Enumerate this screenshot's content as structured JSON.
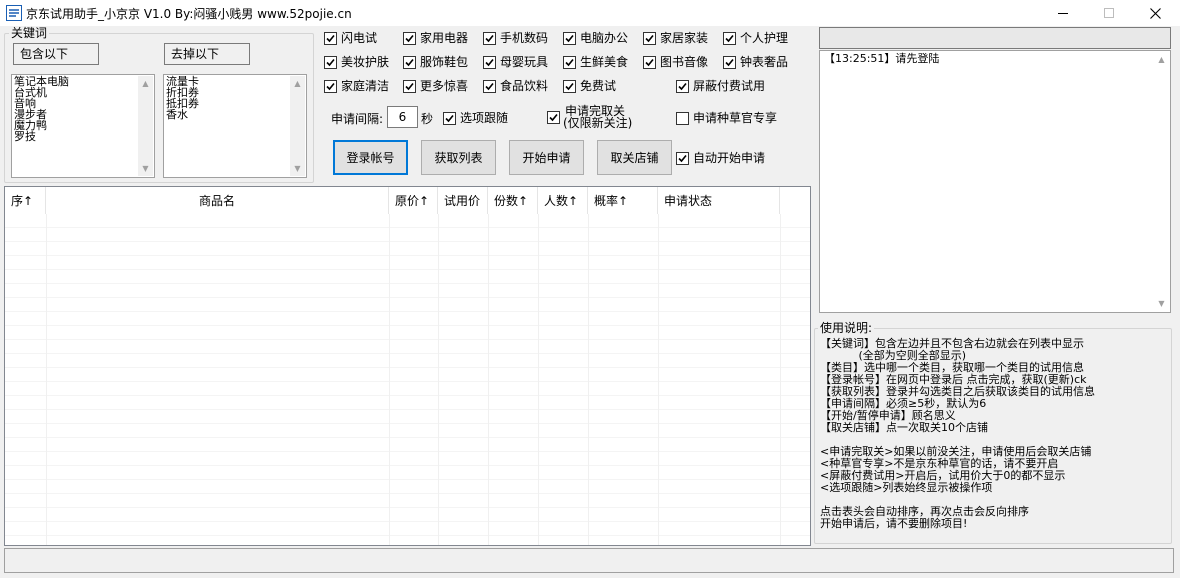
{
  "window": {
    "title": "京东试用助手_小京京 V1.0 By:闷骚小贱男 www.52pojie.cn"
  },
  "keywords": {
    "group_title": "关键词",
    "include_label": "包含以下",
    "exclude_label": "去掉以下",
    "include_items": [
      "笔记本电脑",
      "台式机",
      "音响",
      "漫步者",
      "魔力鸭",
      "罗技"
    ],
    "exclude_items": [
      "流量卡",
      "折扣券",
      "抵扣券",
      "香水"
    ]
  },
  "categories": [
    {
      "label": "闪电试",
      "checked": true
    },
    {
      "label": "家用电器",
      "checked": true
    },
    {
      "label": "手机数码",
      "checked": true
    },
    {
      "label": "电脑办公",
      "checked": true
    },
    {
      "label": "家居家装",
      "checked": true
    },
    {
      "label": "个人护理",
      "checked": true
    },
    {
      "label": "美妆护肤",
      "checked": true
    },
    {
      "label": "服饰鞋包",
      "checked": true
    },
    {
      "label": "母婴玩具",
      "checked": true
    },
    {
      "label": "生鲜美食",
      "checked": true
    },
    {
      "label": "图书音像",
      "checked": true
    },
    {
      "label": "钟表奢品",
      "checked": true
    },
    {
      "label": "家庭清洁",
      "checked": true
    },
    {
      "label": "更多惊喜",
      "checked": true
    },
    {
      "label": "食品饮料",
      "checked": true
    },
    {
      "label": "免费试",
      "checked": true
    }
  ],
  "options": {
    "block_paid_label": "屏蔽付费试用",
    "block_paid_checked": true,
    "interval_label": "申请间隔:",
    "interval_value": "6",
    "interval_unit": "秒",
    "follow_label": "选项跟随",
    "follow_checked": true,
    "unfollow_line1": "申请完取关",
    "unfollow_line2": "(仅限新关注)",
    "unfollow_checked": true,
    "grass_label": "申请种草官专享",
    "grass_checked": false,
    "auto_start_label": "自动开始申请",
    "auto_start_checked": true
  },
  "buttons": {
    "login": "登录帐号",
    "get_list": "获取列表",
    "start": "开始申请",
    "unfollow": "取关店铺"
  },
  "table": {
    "columns": [
      "序↑",
      "商品名",
      "原价↑",
      "试用价",
      "份数↑",
      "人数↑",
      "概率↑",
      "申请状态"
    ]
  },
  "log": {
    "lines": [
      "【13:25:51】请先登陆"
    ]
  },
  "instructions": {
    "title": "使用说明:",
    "text": "【关键词】包含左边并且不包含右边就会在列表中显示\n           (全部为空则全部显示)\n【类目】选中哪一个类目，获取哪一个类目的试用信息\n【登录帐号】在网页中登录后 点击完成，获取(更新)ck\n【获取列表】登录并勾选类目之后获取该类目的试用信息\n【申请间隔】必须≥5秒，默认为6\n【开始/暂停申请】顾名思义\n【取关店铺】点一次取关10个店铺\n\n<申请完取关>如果以前没关注，申请使用后会取关店铺\n<种草官专享>不是京东种草官的话，请不要开启\n<屏蔽付费试用>开启后，试用价大于0的都不显示\n<选项跟随>列表始终显示被操作项\n\n点击表头会自动排序，再次点击会反向排序\n开始申请后，请不要删除项目!"
  }
}
